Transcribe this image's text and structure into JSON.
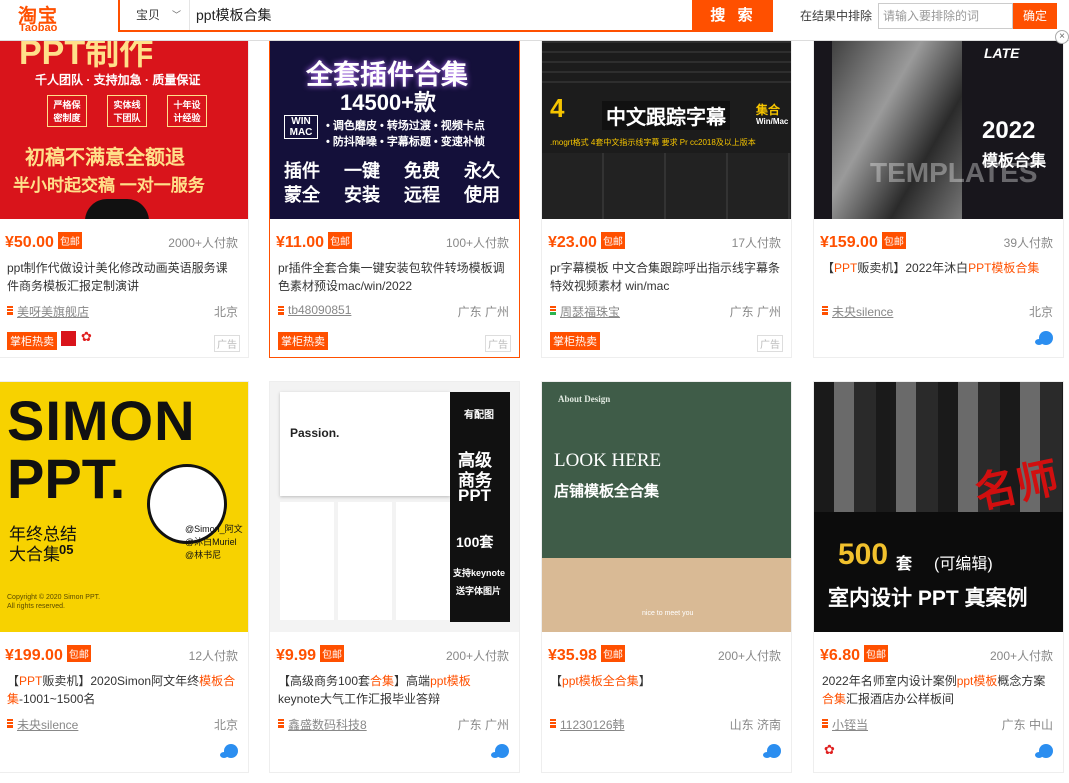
{
  "header": {
    "logo_zh": "淘宝",
    "logo_en": "Taobao",
    "search_category": "宝贝",
    "search_query": "ppt模板合集",
    "search_button": "搜 索",
    "exclude_label": "在结果中排除",
    "exclude_placeholder": "请输入要排除的词",
    "exclude_button": "确定",
    "close_label": "×"
  },
  "baoyou": "包邮",
  "hot_tag": "掌柜热卖",
  "ad_tag": "广告",
  "products": [
    {
      "thumb_lines": [
        "PPT制作",
        "千人团队 · 支持加急 · 质量保证",
        "严格保密制度",
        "实体线下团队",
        "十年设计经验",
        "初稿不满意全额退",
        "半小时起交稿 一对一服务"
      ],
      "price": "¥50.00",
      "sold": "2000+人付款",
      "title": "ppt制作代做设计美化修改动画英语服务课件商务模板汇报定制演讲",
      "shop": "美呀美旗舰店",
      "location": "北京"
    },
    {
      "thumb_lines": [
        "全套插件合集",
        "14500+款",
        "WIN MAC",
        "• 调色磨皮 • 转场过渡 • 视频卡点",
        "• 防抖降噪 • 字幕标题 • 变速补帧",
        "插件",
        "一键",
        "免费",
        "永久",
        "蒙全",
        "安装",
        "远程",
        "使用"
      ],
      "price": "¥11.00",
      "sold": "100+人付款",
      "title": "pr插件全套合集一键安装包软件转场模板调色素材预设mac/win/2022",
      "shop": "tb48090851",
      "location": "广东 广州"
    },
    {
      "thumb_lines": [
        "4",
        "中文跟踪字幕",
        "集合",
        "Win/Mac",
        ".mogrt格式 4套中文指示线字幕 要求 Pr cc2018及以上版本"
      ],
      "price": "¥23.00",
      "sold": "17人付款",
      "title": "pr字幕模板 中文合集跟踪呼出指示线字幕条特效视频素材 win/mac",
      "shop": "周瑟福珠宝",
      "location": "广东 广州"
    },
    {
      "thumb_lines": [
        "LATE",
        "2022",
        "模板合集",
        "TEMPLATES"
      ],
      "price": "¥159.00",
      "sold": "39人付款",
      "title_parts": [
        [
          "【",
          false
        ],
        [
          "PPT",
          true
        ],
        [
          "贩卖机】2022年沐白",
          false
        ],
        [
          "PPT",
          true
        ],
        [
          "模板合集",
          true
        ]
      ],
      "shop": "未央silence",
      "location": "北京"
    },
    {
      "thumb_lines": [
        "SIMON",
        "PPT.",
        "年终总结",
        "大合集",
        "05",
        "@Simon_阿文",
        "@沐白Muriel",
        "@林书尼",
        "Copyright © 2020 Simon PPT.",
        "All rights reserved."
      ],
      "price": "¥199.00",
      "sold": "12人付款",
      "title_parts": [
        [
          "【",
          false
        ],
        [
          "PPT",
          true
        ],
        [
          "贩卖机】2020Simon阿文年终",
          false
        ],
        [
          "模板合集",
          true
        ],
        [
          "-1001~1500名",
          false
        ]
      ],
      "shop": "未央silence",
      "location": "北京"
    },
    {
      "thumb_lines": [
        "Passion.",
        "有配图",
        "高级",
        "商务",
        "PPT",
        "100套",
        "支持keynote",
        "送字体图片"
      ],
      "price": "¥9.99",
      "sold": "200+人付款",
      "title_parts": [
        [
          "【高级商务100套",
          false
        ],
        [
          "合集",
          true
        ],
        [
          "】高端",
          false
        ],
        [
          "ppt",
          true
        ],
        [
          "模板",
          true
        ],
        [
          "keynote大气工作汇报毕业答辩",
          false
        ]
      ],
      "shop": "鑫盛数码科技8",
      "location": "广东 广州"
    },
    {
      "thumb_lines": [
        "About Design",
        "LOOK HERE",
        "店铺模板全合集",
        "nice to meet you"
      ],
      "price": "¥35.98",
      "sold": "200+人付款",
      "title_parts": [
        [
          "【",
          false
        ],
        [
          "ppt",
          true
        ],
        [
          "模板",
          true
        ],
        [
          "全合集",
          true
        ],
        [
          "】",
          false
        ]
      ],
      "shop": "11230126韩",
      "location": "山东 济南"
    },
    {
      "thumb_lines": [
        "名师",
        "500",
        "套",
        "(可编辑)",
        "室内设计 PPT 真案例"
      ],
      "price": "¥6.80",
      "sold": "200+人付款",
      "title_parts": [
        [
          "2022年名师室内设计案例",
          false
        ],
        [
          "ppt",
          true
        ],
        [
          "模板",
          true
        ],
        [
          "概念方案",
          false
        ],
        [
          "合集",
          true
        ],
        [
          "汇报酒店办公样板间",
          false
        ]
      ],
      "shop": "小铚当",
      "location": "广东 中山"
    }
  ]
}
